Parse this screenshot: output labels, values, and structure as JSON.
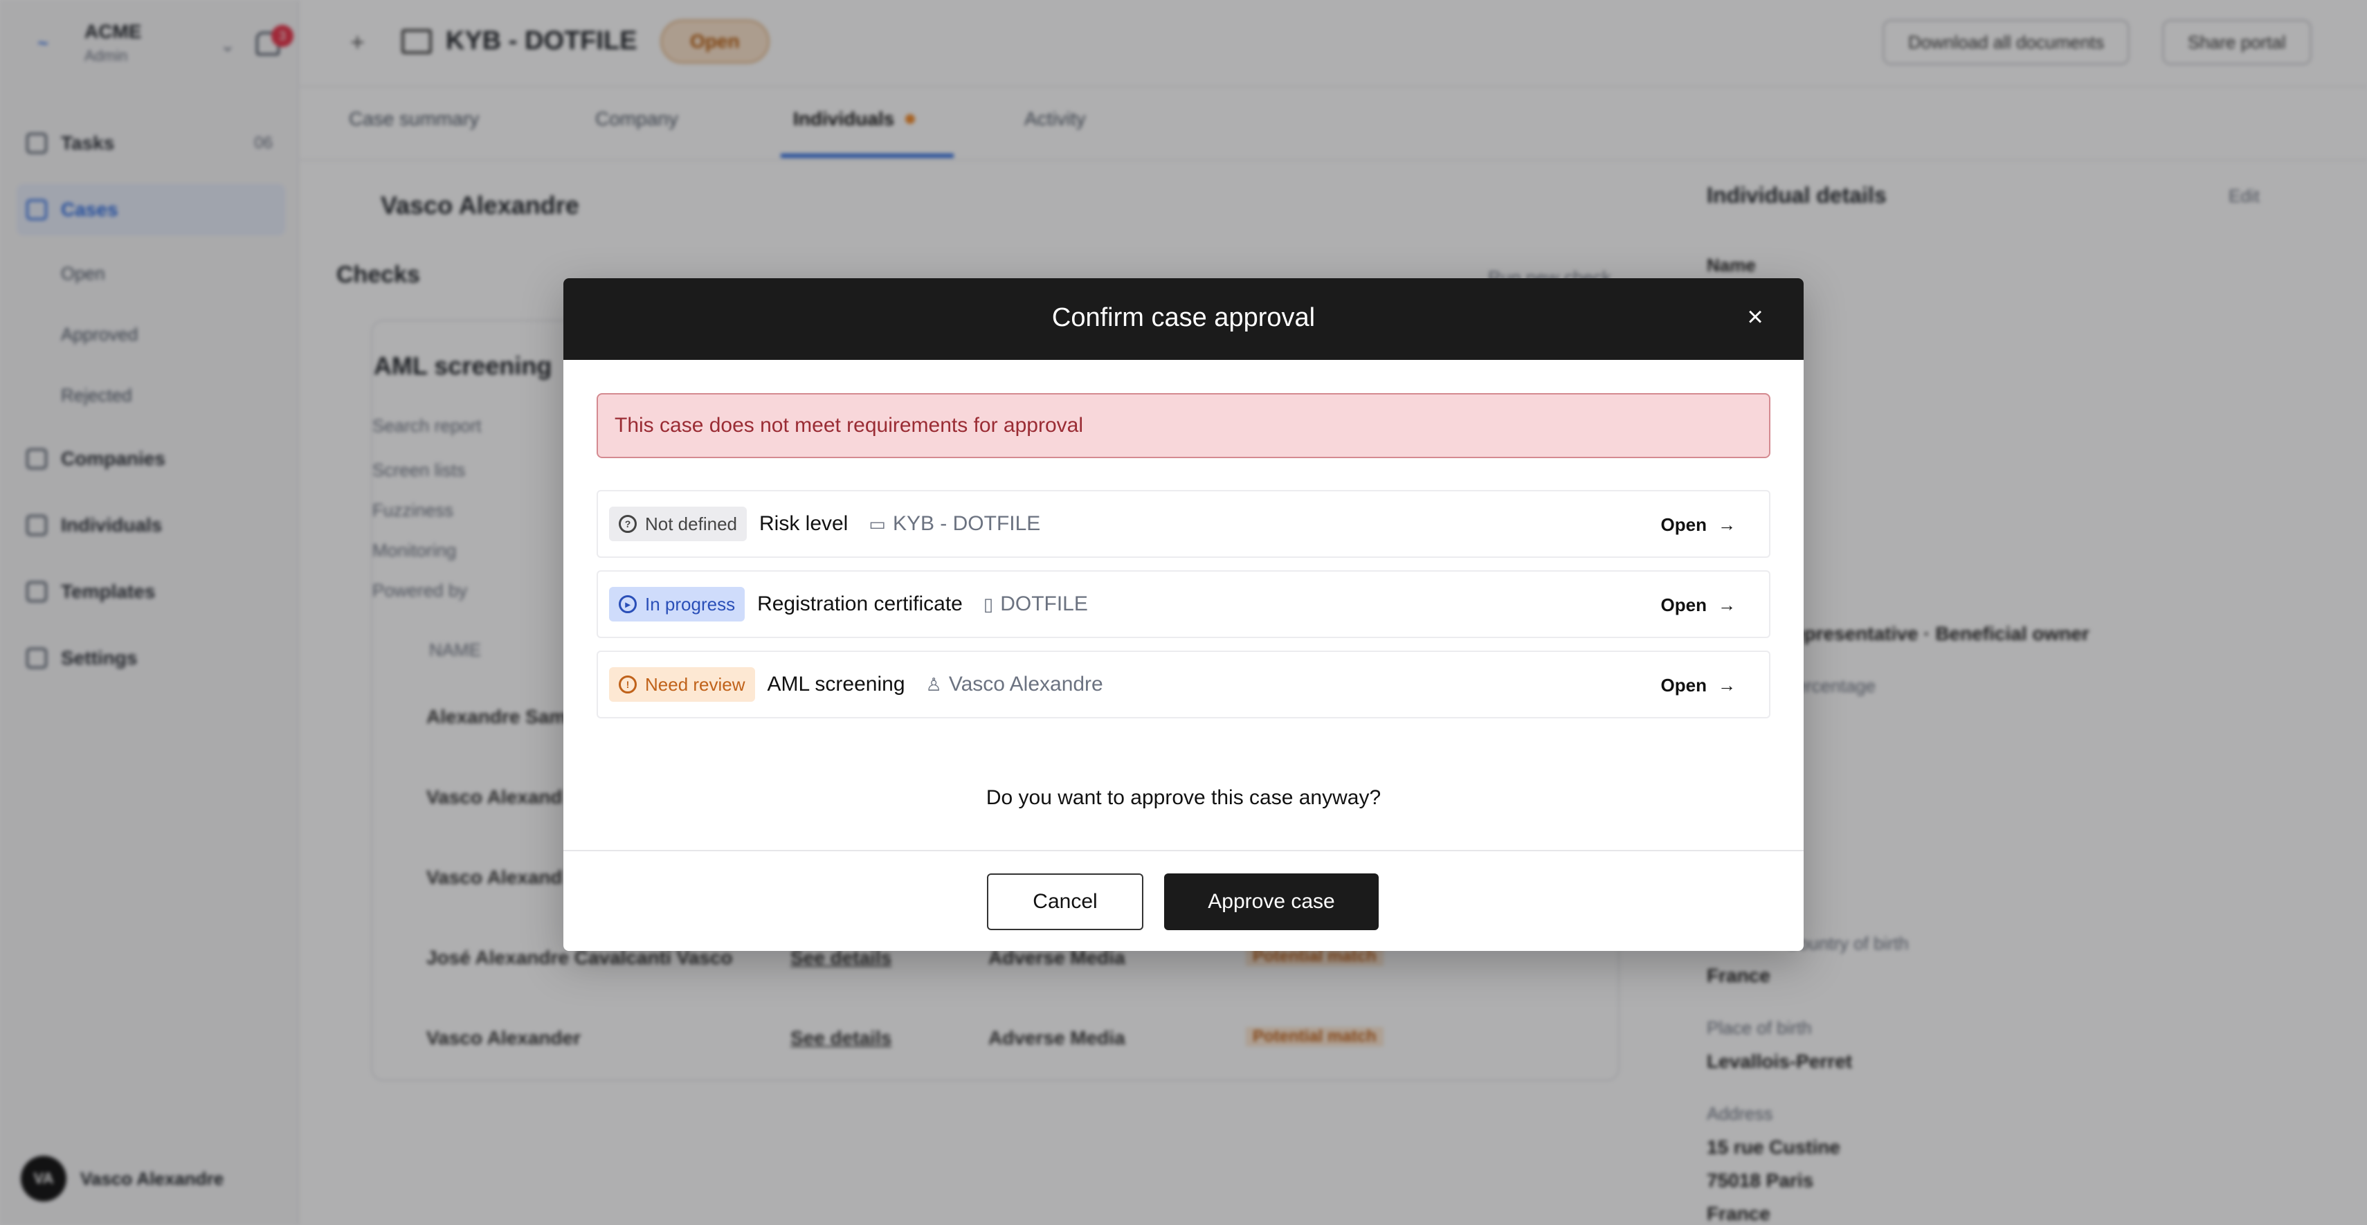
{
  "sidebar": {
    "brand_name": "ACME",
    "brand_role": "Admin",
    "notifications_count": "3",
    "items": [
      {
        "label": "Tasks",
        "count": "06"
      },
      {
        "label": "Cases"
      },
      {
        "label": "Companies"
      },
      {
        "label": "Individuals"
      },
      {
        "label": "Templates"
      },
      {
        "label": "Settings"
      }
    ],
    "case_subitems": [
      "Open",
      "Approved",
      "Rejected"
    ],
    "user_initials": "VA",
    "user_name": "Vasco Alexandre"
  },
  "header": {
    "case_title": "KYB - DOTFILE",
    "status": "Open",
    "download_label": "Download all documents",
    "share_label": "Share portal"
  },
  "tabs": [
    "Case summary",
    "Company",
    "Individuals",
    "Activity"
  ],
  "main": {
    "person_name": "Vasco Alexandre",
    "checks_title": "Checks",
    "run_check_label": "Run new check",
    "aml_title": "AML screening",
    "meta_rows": [
      "Search report",
      "Screen lists",
      "Fuzziness",
      "Monitoring",
      "Powered by"
    ],
    "table_header": "NAME",
    "rows": [
      "Alexandre Sam",
      "Vasco Alexand",
      "Vasco Alexand",
      "José Alexandre Cavalcanti Vasco",
      "Vasco Alexander"
    ],
    "row_detail_link": "See details",
    "row_type": "Adverse Media",
    "row_status": "Potential match"
  },
  "details": {
    "title": "Individual details",
    "edit_label": "Edit",
    "name_label": "Name",
    "roles": "representative · Beneficial owner",
    "ownership_label": "percentage",
    "country_label": "Country of birth",
    "country_value": "France",
    "place_label": "Place of birth",
    "place_value": "Levallois-Perret",
    "address_label": "Address",
    "address_line1": "15 rue Custine",
    "address_line2": "75018 Paris",
    "address_line3": "France"
  },
  "modal": {
    "title": "Confirm case approval",
    "alert": "This case does not meet requirements for approval",
    "requirements": [
      {
        "status": "Not defined",
        "name": "Risk level",
        "ref_icon": "folder-icon",
        "ref": "KYB - DOTFILE",
        "action": "Open"
      },
      {
        "status": "In progress",
        "name": "Registration certificate",
        "ref_icon": "building-icon",
        "ref": "DOTFILE",
        "action": "Open"
      },
      {
        "status": "Need review",
        "name": "AML screening",
        "ref_icon": "person-icon",
        "ref": "Vasco Alexandre",
        "action": "Open"
      }
    ],
    "question": "Do you want to approve this case anyway?",
    "cancel_label": "Cancel",
    "approve_label": "Approve case"
  },
  "colors": {
    "accent": "#2a6ae0",
    "danger_bg": "#f8d7da",
    "danger_text": "#9a2c34",
    "modal_header": "#1b1b1b"
  }
}
